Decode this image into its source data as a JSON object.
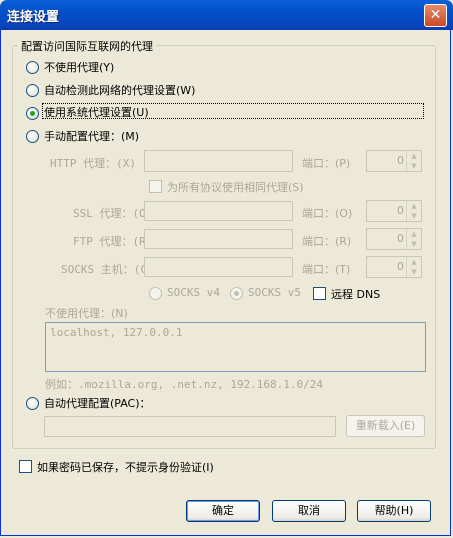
{
  "window": {
    "title": "连接设置",
    "close_label": "✕"
  },
  "group_label": "配置访问国际互联网的代理",
  "options": {
    "no_proxy": "不使用代理(Y)",
    "auto_detect": "自动检测此网络的代理设置(W)",
    "system_proxy": "使用系统代理设置(U)",
    "manual": "手动配置代理：(M)",
    "auto_config": "自动代理配置(PAC)："
  },
  "manual": {
    "http_label": "HTTP 代理：(X)",
    "ssl_label": "SSL 代理：(O)",
    "ftp_label": "FTP 代理：(R)",
    "socks_label": "SOCKS 主机：(C)",
    "port_label_http": "端口：(P)",
    "port_label_ssl": "端口：(O)",
    "port_label_ftp": "端口：(R)",
    "port_label_socks": "端口：(T)",
    "port_value": "0",
    "same_proxy": "为所有协议使用相同代理(S)",
    "socks_v4": "SOCKS v4",
    "socks_v5": "SOCKS v5",
    "remote_dns": "远程 DNS"
  },
  "no_proxy_for": {
    "label": "不使用代理：(N)",
    "value": "localhost, 127.0.0.1",
    "example": "例如：.mozilla.org, .net.nz, 192.168.1.0/24"
  },
  "pac": {
    "url": "",
    "reload_label": "重新载入(E)"
  },
  "remember_auth": "如果密码已保存，不提示身份验证(I)",
  "buttons": {
    "ok": "确定",
    "cancel": "取消",
    "help": "帮助(H)"
  },
  "selected_option": "system_proxy"
}
